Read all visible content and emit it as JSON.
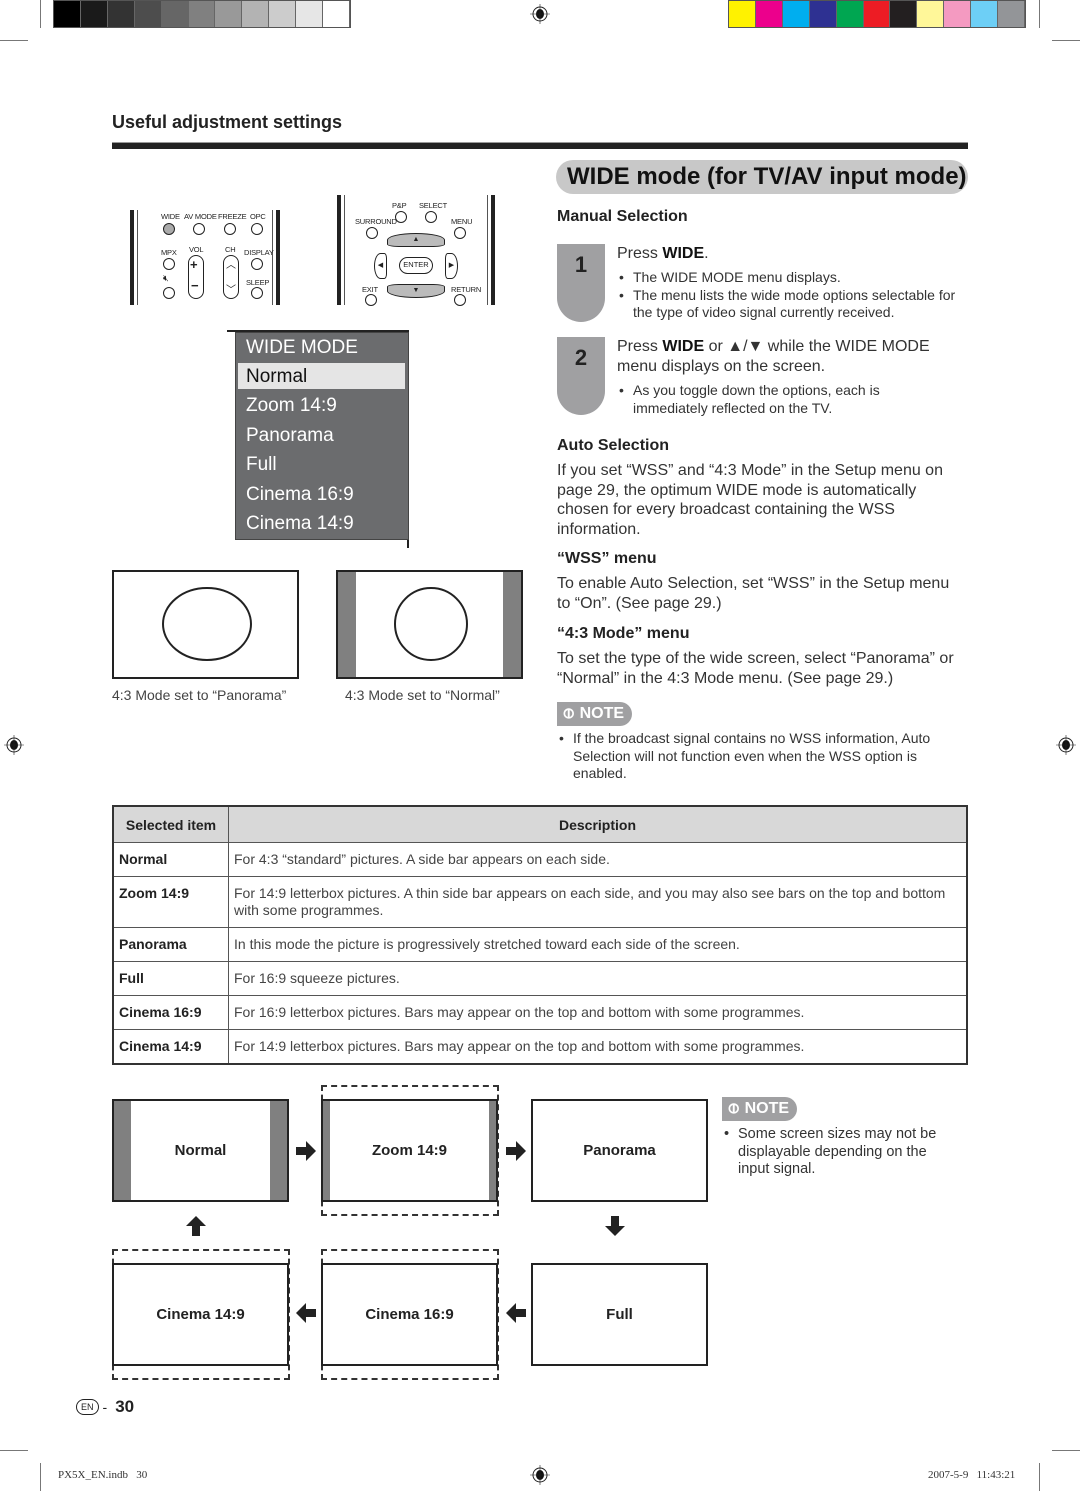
{
  "print_marks": {
    "grayscale_swatches": [
      "#000000",
      "#1a1a1a",
      "#333333",
      "#4d4d4d",
      "#666666",
      "#808080",
      "#999999",
      "#b3b3b3",
      "#cccccc",
      "#e6e6e6",
      "#ffffff"
    ],
    "color_swatches": [
      "#fff200",
      "#ec008c",
      "#00aeef",
      "#2e3192",
      "#00a651",
      "#ed1c24",
      "#231f20",
      "#fff799",
      "#f49ac1",
      "#6dcff6",
      "#939598"
    ]
  },
  "header": {
    "section_title": "Useful adjustment settings",
    "page_heading": "WIDE mode (for TV/AV input mode)"
  },
  "remote": {
    "left_labels": [
      "WIDE",
      "AV MODE",
      "FREEZE",
      "OPC",
      "MPX",
      "VOL",
      "CH",
      "DISPLAY",
      "SLEEP"
    ],
    "right_labels": [
      "P&P",
      "SELECT",
      "SURROUND",
      "MENU",
      "ENTER",
      "EXIT",
      "RETURN"
    ]
  },
  "osd_menu": {
    "title": "WIDE MODE",
    "items": [
      "Normal",
      "Zoom 14:9",
      "Panorama",
      "Full",
      "Cinema 16:9",
      "Cinema 14:9"
    ],
    "selected": "Normal"
  },
  "illustrations": {
    "panorama_caption": "4:3 Mode set to “Panorama”",
    "normal_caption": "4:3 Mode set to “Normal”"
  },
  "manual_selection": {
    "heading": "Manual Selection",
    "steps": [
      {
        "number": "1",
        "text_prefix": "Press ",
        "text_bold": "WIDE",
        "text_suffix": ".",
        "bullets": [
          "The WIDE MODE menu displays.",
          "The menu lists the wide mode options selectable for the type of video signal currently received."
        ]
      },
      {
        "number": "2",
        "text_prefix": "Press ",
        "text_bold": "WIDE",
        "text_suffix": " or ▲/▼ while the WIDE MODE menu displays on the screen.",
        "bullets": [
          "As you toggle down the options, each is immediately reflected on the TV."
        ]
      }
    ]
  },
  "auto_selection": {
    "heading": "Auto Selection",
    "text": "If you set “WSS” and “4:3 Mode” in the Setup menu on page 29, the optimum WIDE mode is automatically chosen for every broadcast containing the WSS information."
  },
  "wss_menu": {
    "heading": "“WSS” menu",
    "text": "To enable Auto Selection, set “WSS” in the Setup menu to “On”. (See page 29.)"
  },
  "mode43_menu": {
    "heading": "“4:3 Mode” menu",
    "text": "To set the type of the wide screen, select “Panorama” or “Normal” in the 4:3 Mode menu. (See page 29.)"
  },
  "note1": {
    "badge": "NOTE",
    "bullets": [
      "If the broadcast signal contains no WSS information, Auto Selection will not function even when the WSS option is enabled."
    ]
  },
  "table": {
    "headers": [
      "Selected item",
      "Description"
    ],
    "rows": [
      {
        "item": "Normal",
        "description": "For 4:3 “standard” pictures. A side bar appears on each side."
      },
      {
        "item": "Zoom 14:9",
        "description": "For 14:9 letterbox pictures. A thin side bar appears on each side, and you may also see bars on the top and bottom with some programmes."
      },
      {
        "item": "Panorama",
        "description": "In this mode the picture is progressively stretched toward each side of the screen."
      },
      {
        "item": "Full",
        "description": "For 16:9 squeeze pictures."
      },
      {
        "item": "Cinema 16:9",
        "description": "For 16:9 letterbox pictures. Bars may appear on the top and bottom with some programmes."
      },
      {
        "item": "Cinema 14:9",
        "description": "For 14:9 letterbox pictures. Bars may appear on the top and bottom with some programmes."
      }
    ]
  },
  "flow": {
    "boxes": [
      "Normal",
      "Zoom 14:9",
      "Panorama",
      "Full",
      "Cinema 16:9",
      "Cinema 14:9"
    ]
  },
  "note2": {
    "badge": "NOTE",
    "bullets": [
      "Some screen sizes may not be displayable depending on the input signal."
    ]
  },
  "page_number": {
    "lang_badge": "EN",
    "separator": "-",
    "number": "30"
  },
  "footer": {
    "file": "PX5X_EN.indb   30",
    "timestamp": "2007-5-9   11:43:21"
  }
}
